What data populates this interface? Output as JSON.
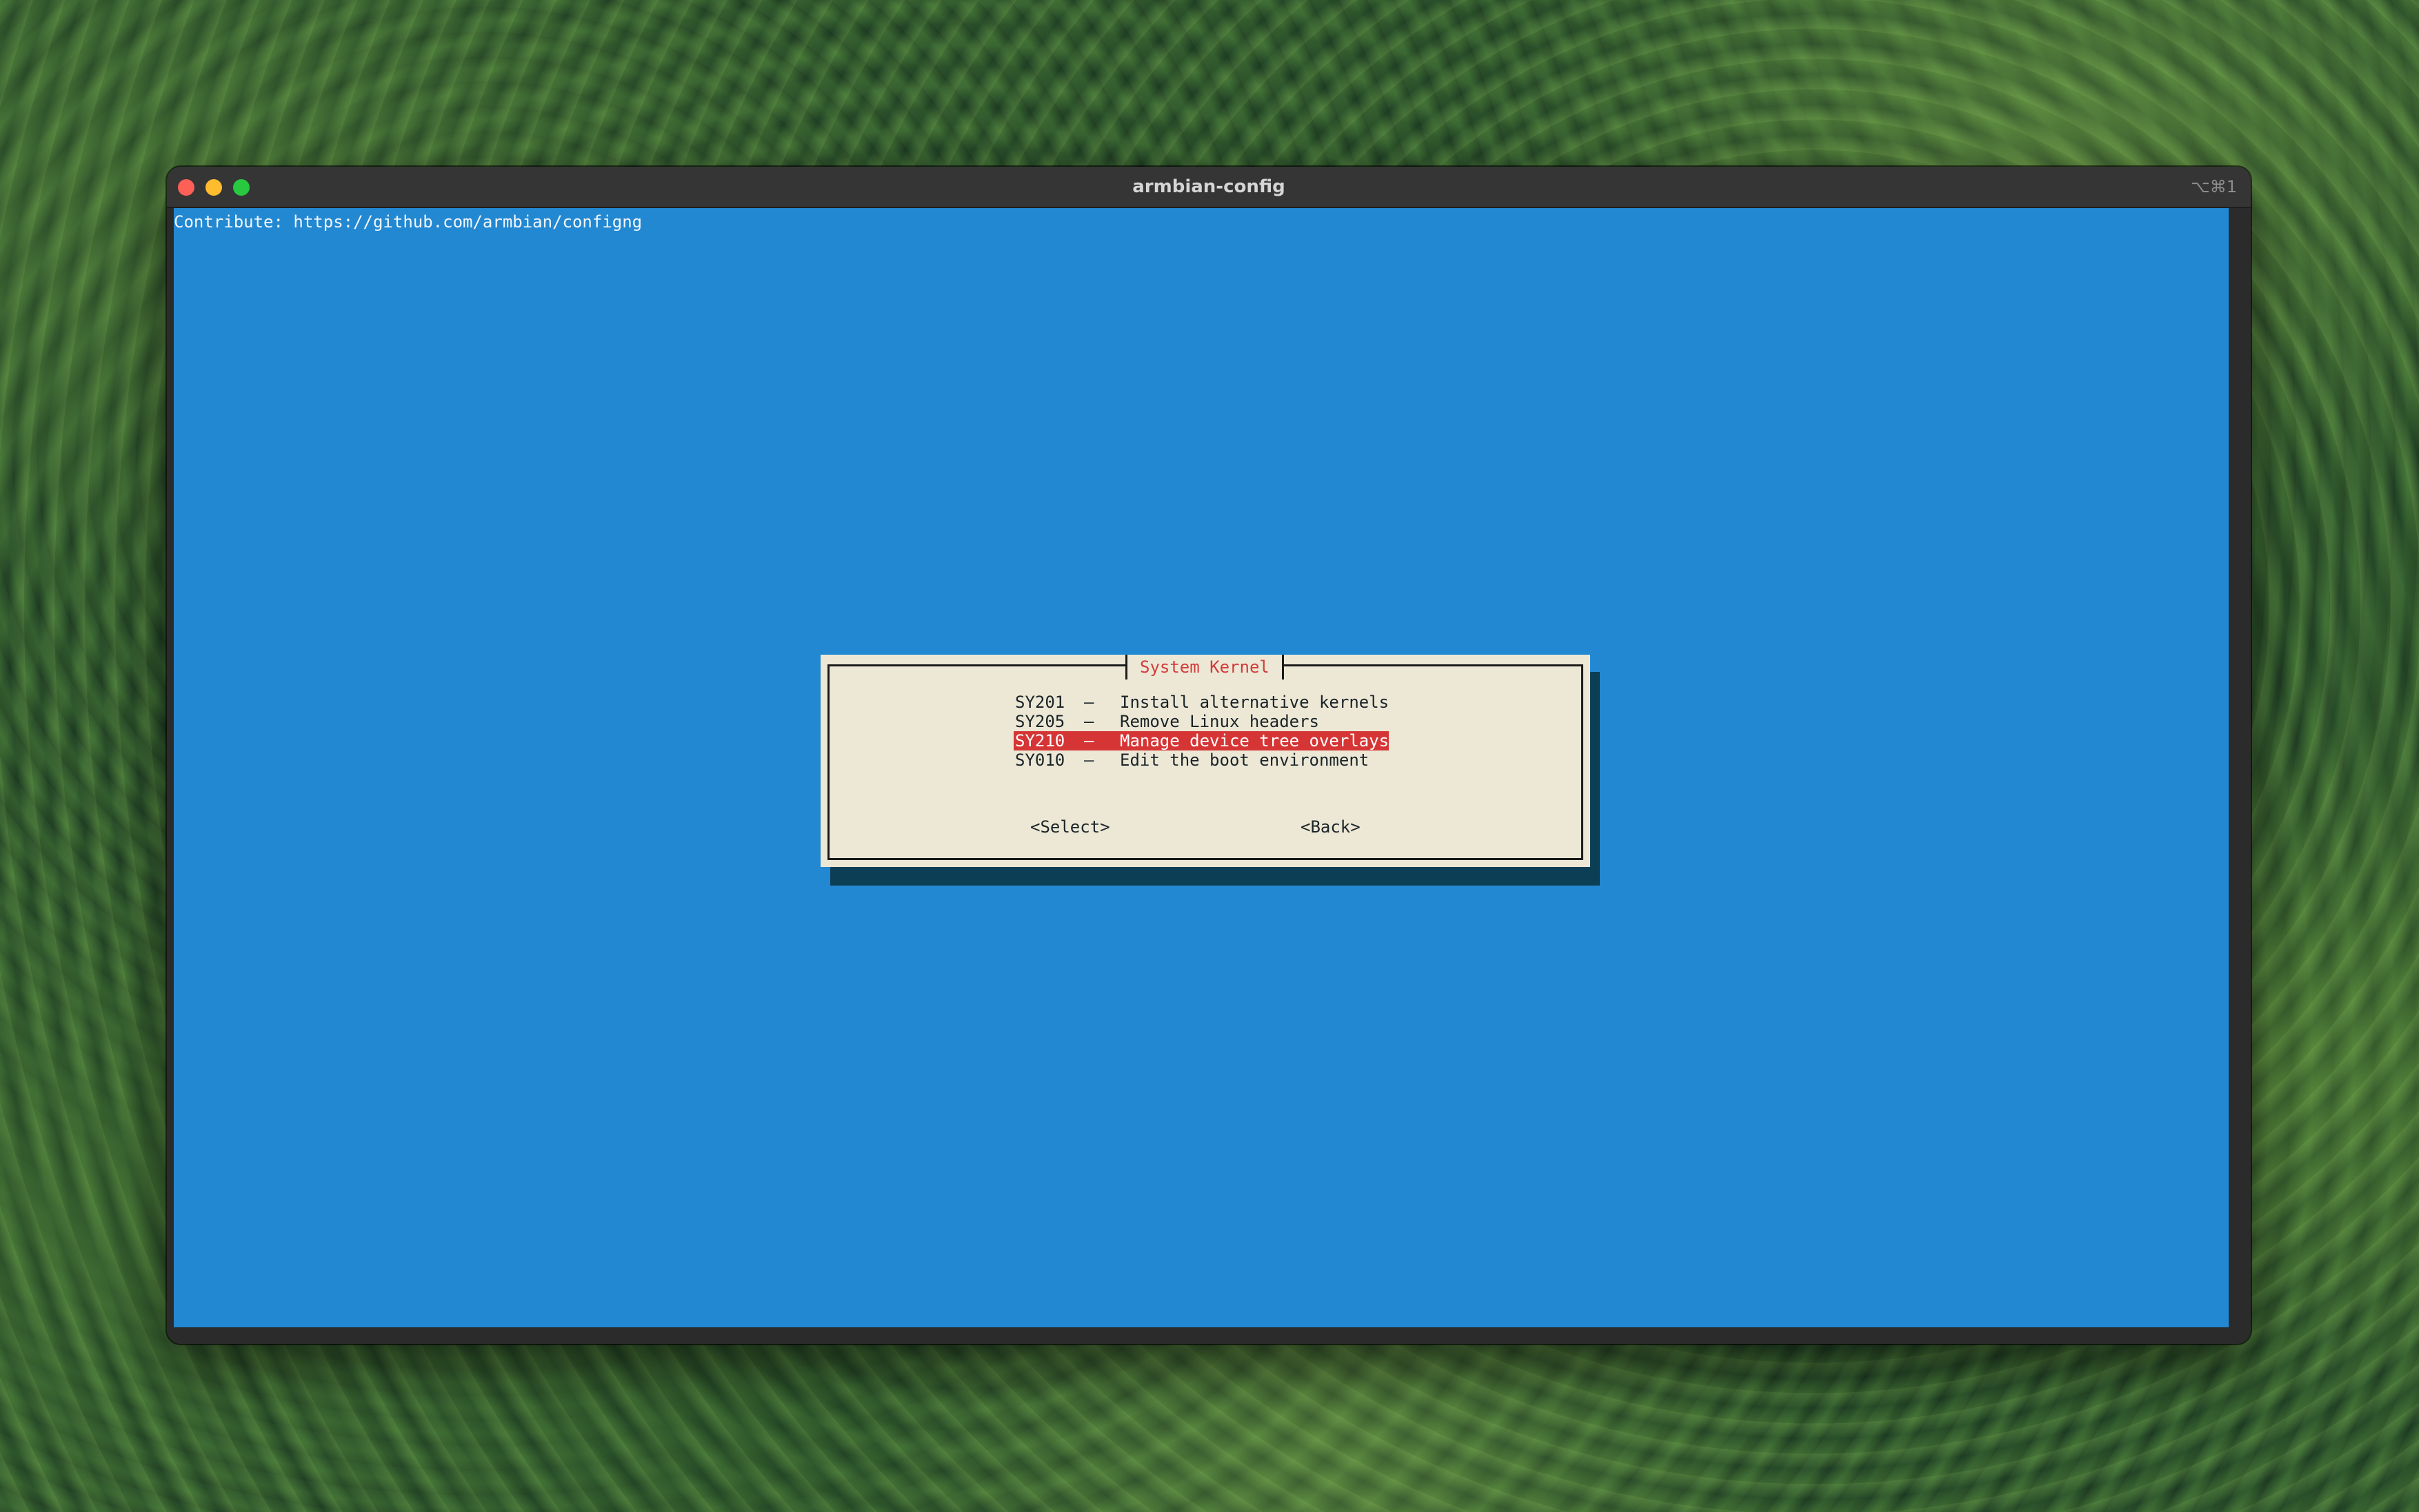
{
  "window": {
    "title": "armbian-config",
    "shortcut": "⌥⌘1"
  },
  "terminal": {
    "contribute": "Contribute: https://github.com/armbian/configng"
  },
  "dialog": {
    "title": "System Kernel",
    "items": [
      {
        "code": "SY201",
        "dash": "–",
        "label": "Install alternative kernels"
      },
      {
        "code": "SY205",
        "dash": "–",
        "label": "Remove Linux headers"
      },
      {
        "code": "SY210",
        "dash": "–",
        "label": "Manage device tree overlays"
      },
      {
        "code": "SY010",
        "dash": "–",
        "label": "Edit the boot environment"
      }
    ],
    "selected_index": 2,
    "select_button": "<Select>",
    "back_button": "<Back>"
  },
  "colors": {
    "terminal_bg": "#2288d2",
    "dialog_bg": "#ede8d6",
    "accent": "#d63535"
  }
}
